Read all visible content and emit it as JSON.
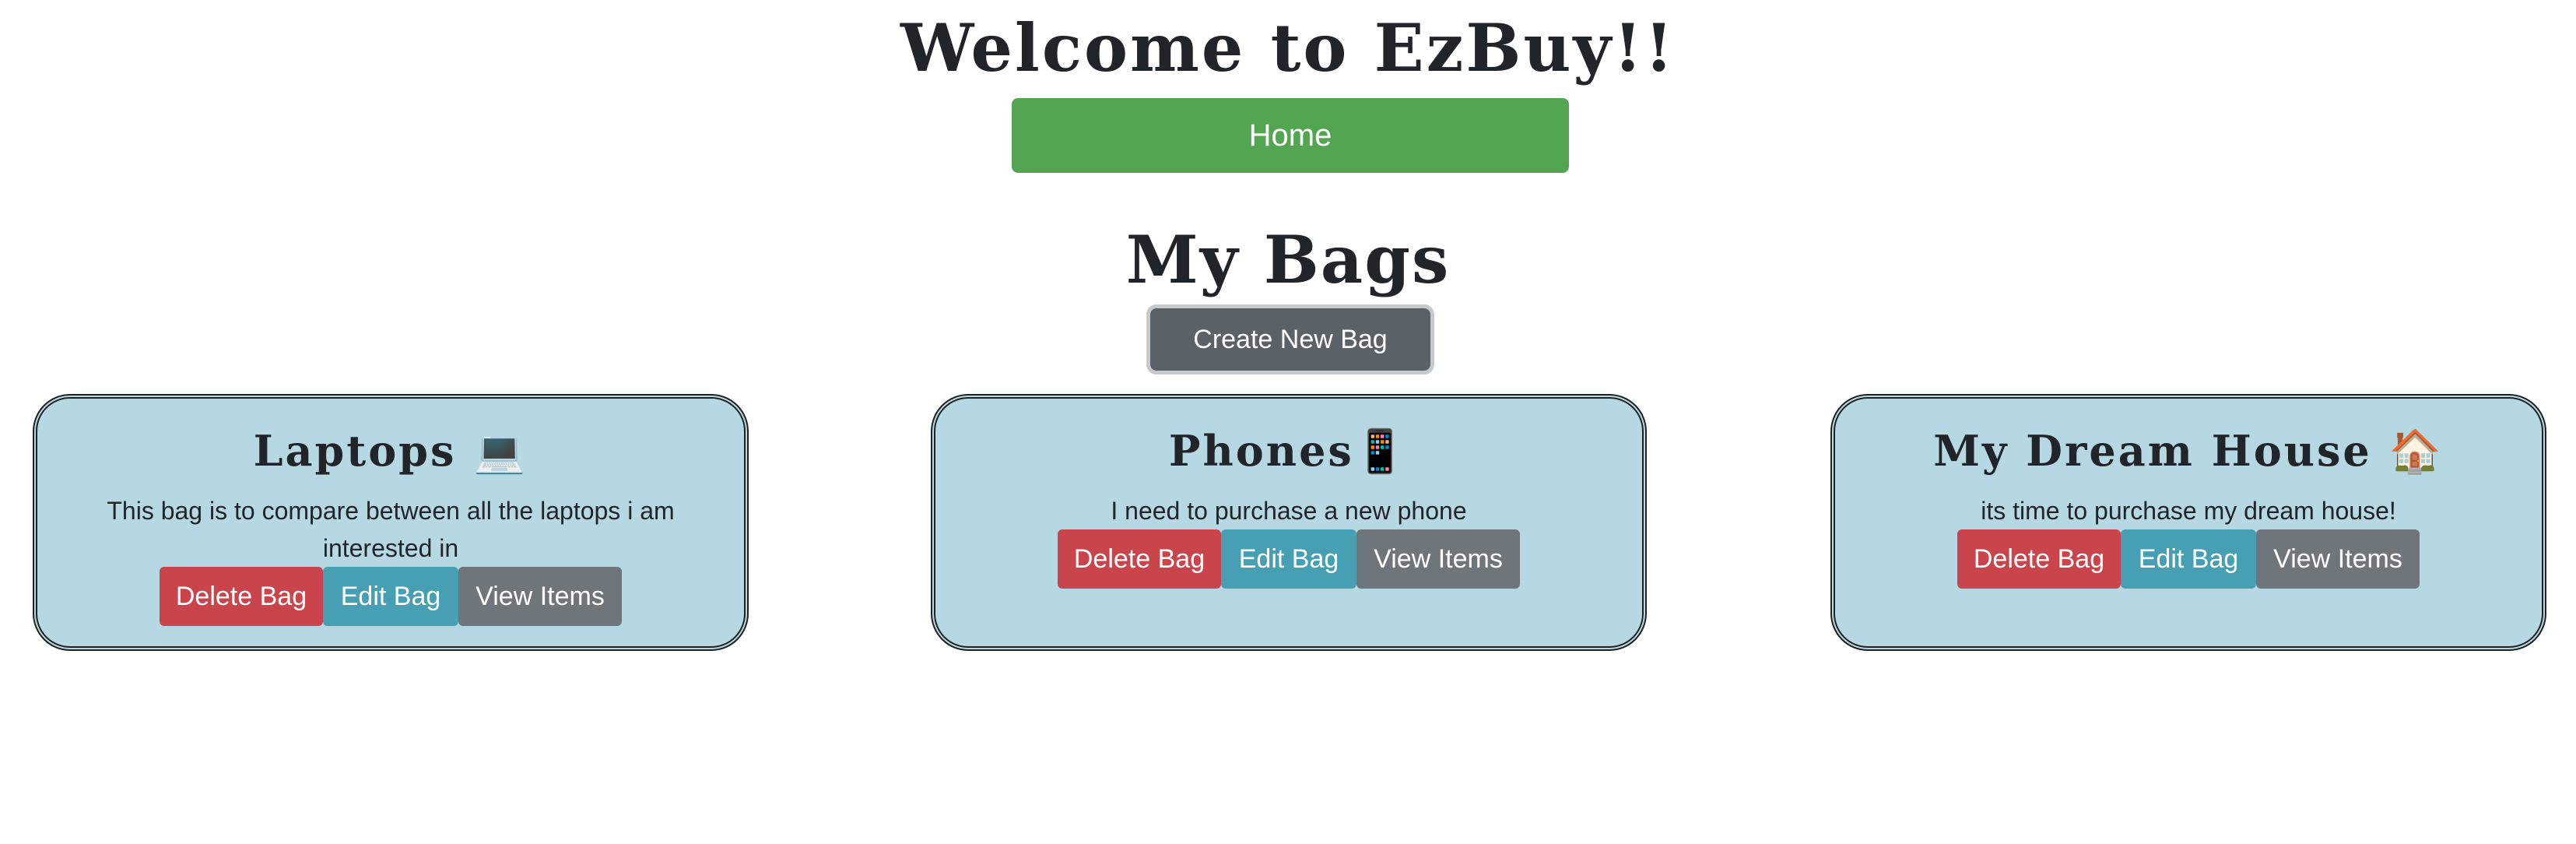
{
  "header": {
    "title": "Welcome to EzBuy!!",
    "home_label": "Home"
  },
  "bags_section": {
    "title": "My Bags",
    "create_label": "Create New Bag"
  },
  "bags": [
    {
      "name": "Laptops 💻",
      "description": "This bag is to compare between all the laptops i am interested in",
      "delete_label": "Delete Bag",
      "edit_label": "Edit Bag",
      "view_label": "View Items"
    },
    {
      "name": "Phones📱",
      "description": "I need to purchase a new phone",
      "delete_label": "Delete Bag",
      "edit_label": "Edit Bag",
      "view_label": "View Items"
    },
    {
      "name": "My Dream House 🏠",
      "description": "its time to purchase my dream house!",
      "delete_label": "Delete Bag",
      "edit_label": "Edit Bag",
      "view_label": "View Items"
    }
  ],
  "colors": {
    "home_button": "#53a551",
    "create_button": "#5a6268",
    "card_background": "#b6d8e3",
    "delete_button": "#ca444c",
    "edit_button": "#469fb2",
    "view_button": "#6e757b"
  }
}
